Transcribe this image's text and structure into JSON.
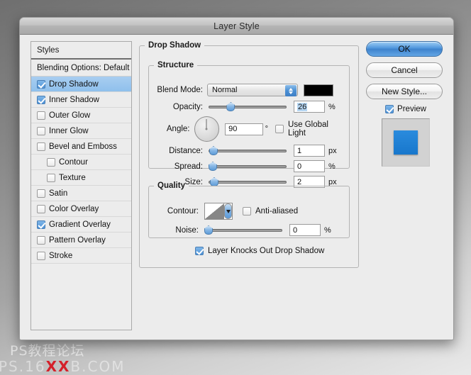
{
  "dialog": {
    "title": "Layer Style"
  },
  "styles_panel": {
    "header": "Styles",
    "blending_options": "Blending Options: Default",
    "items": [
      {
        "label": "Drop Shadow",
        "checked": true,
        "selected": true,
        "indent": false
      },
      {
        "label": "Inner Shadow",
        "checked": true,
        "selected": false,
        "indent": false
      },
      {
        "label": "Outer Glow",
        "checked": false,
        "selected": false,
        "indent": false
      },
      {
        "label": "Inner Glow",
        "checked": false,
        "selected": false,
        "indent": false
      },
      {
        "label": "Bevel and Emboss",
        "checked": false,
        "selected": false,
        "indent": false
      },
      {
        "label": "Contour",
        "checked": false,
        "selected": false,
        "indent": true
      },
      {
        "label": "Texture",
        "checked": false,
        "selected": false,
        "indent": true
      },
      {
        "label": "Satin",
        "checked": false,
        "selected": false,
        "indent": false
      },
      {
        "label": "Color Overlay",
        "checked": false,
        "selected": false,
        "indent": false
      },
      {
        "label": "Gradient Overlay",
        "checked": true,
        "selected": false,
        "indent": false
      },
      {
        "label": "Pattern Overlay",
        "checked": false,
        "selected": false,
        "indent": false
      },
      {
        "label": "Stroke",
        "checked": false,
        "selected": false,
        "indent": false
      }
    ]
  },
  "main": {
    "group_title": "Drop Shadow",
    "structure": {
      "title": "Structure",
      "blend_mode_label": "Blend Mode:",
      "blend_mode_value": "Normal",
      "shadow_color": "#000000",
      "opacity_label": "Opacity:",
      "opacity_value": "26",
      "opacity_unit": "%",
      "opacity_percent": 26,
      "angle_label": "Angle:",
      "angle_value": "90",
      "angle_unit": "°",
      "angle_degrees": 90,
      "use_global_light_label": "Use Global Light",
      "use_global_light_checked": false,
      "distance_label": "Distance:",
      "distance_value": "1",
      "distance_unit": "px",
      "distance_percent": 1,
      "spread_label": "Spread:",
      "spread_value": "0",
      "spread_unit": "%",
      "spread_percent": 0,
      "size_label": "Size:",
      "size_value": "2",
      "size_unit": "px",
      "size_percent": 2
    },
    "quality": {
      "title": "Quality",
      "contour_label": "Contour:",
      "anti_aliased_label": "Anti-aliased",
      "anti_aliased_checked": false,
      "noise_label": "Noise:",
      "noise_value": "0",
      "noise_unit": "%",
      "noise_percent": 0
    },
    "knockout_label": "Layer Knocks Out Drop Shadow",
    "knockout_checked": true
  },
  "buttons": {
    "ok": "OK",
    "cancel": "Cancel",
    "new_style": "New Style...",
    "preview_label": "Preview",
    "preview_checked": true,
    "preview_color": "#1877cc"
  },
  "watermark": {
    "line1": "PS教程论坛",
    "line2_pre": "PS.16",
    "line2_red": "XX",
    "line2_post": "B.COM"
  },
  "accent": "#4f93d8"
}
